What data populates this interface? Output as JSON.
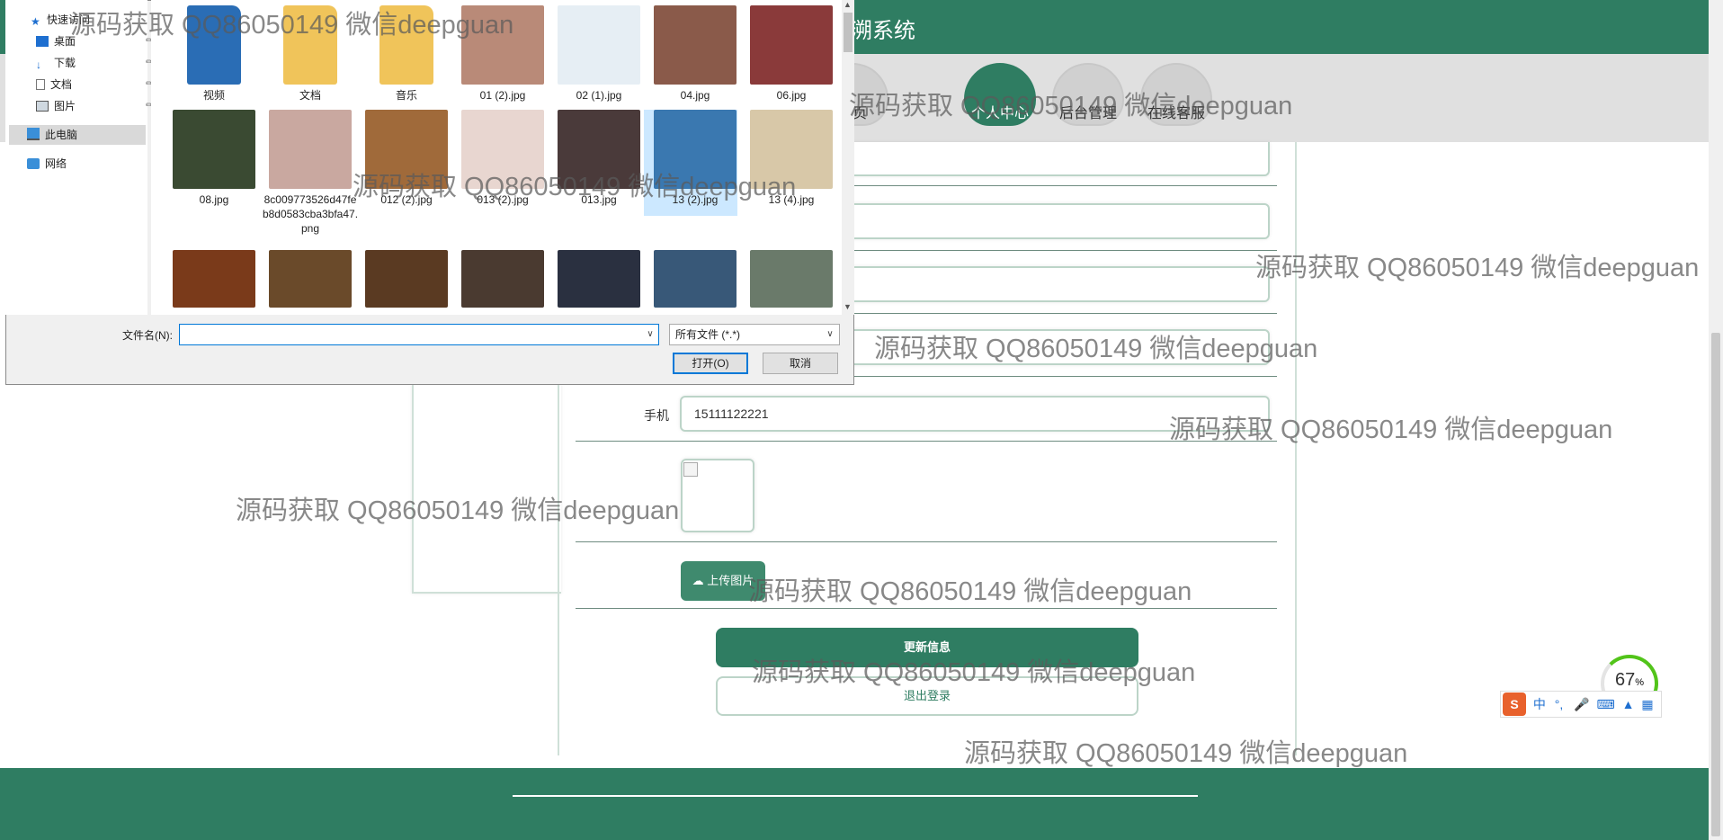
{
  "site": {
    "title": "溯系统",
    "nav": [
      "首页",
      "个人中心",
      "后台管理",
      "在线客服"
    ],
    "active_nav": 1
  },
  "form": {
    "phone_label": "手机",
    "phone_value": "15111122221",
    "upload_label": "上传图片",
    "update_label": "更新信息",
    "logout_label": "退出登录"
  },
  "dialog": {
    "sidebar": {
      "quick_access": "快速访问",
      "desktop": "桌面",
      "downloads": "下载",
      "documents": "文档",
      "pictures": "图片",
      "this_pc": "此电脑",
      "network": "网络"
    },
    "files": [
      {
        "name": "视频",
        "kind": "folder",
        "color": "#2a6db5"
      },
      {
        "name": "文档",
        "kind": "folder",
        "color": "#f0c45a"
      },
      {
        "name": "音乐",
        "kind": "folder",
        "color": "#f0c45a"
      },
      {
        "name": "01 (2).jpg",
        "kind": "image",
        "color": "#b98a78"
      },
      {
        "name": "02 (1).jpg",
        "kind": "image",
        "color": "#e6eef4"
      },
      {
        "name": "04.jpg",
        "kind": "image",
        "color": "#8a5a4a"
      },
      {
        "name": "06.jpg",
        "kind": "image",
        "color": "#8a3a3a"
      },
      {
        "name": "08.jpg",
        "kind": "image",
        "color": "#3a4a32"
      },
      {
        "name": "8c009773526d47feb8d0583cba3bfa47.png",
        "kind": "image",
        "color": "#c9a8a0"
      },
      {
        "name": "012 (2).jpg",
        "kind": "image",
        "color": "#a06a3a"
      },
      {
        "name": "013 (2).jpg",
        "kind": "image",
        "color": "#e8d6d0"
      },
      {
        "name": "013.jpg",
        "kind": "image",
        "color": "#4a3a3a"
      },
      {
        "name": "13 (2).jpg",
        "kind": "image",
        "color": "#3a78b0"
      },
      {
        "name": "13 (4).jpg",
        "kind": "image",
        "color": "#d8c8a8"
      },
      {
        "name": "",
        "kind": "image",
        "color": "#7a3a1a"
      },
      {
        "name": "",
        "kind": "image",
        "color": "#6a4a2a"
      },
      {
        "name": "",
        "kind": "image",
        "color": "#5a3a22"
      },
      {
        "name": "",
        "kind": "image",
        "color": "#4a3a30"
      },
      {
        "name": "",
        "kind": "image",
        "color": "#2a3040"
      },
      {
        "name": "",
        "kind": "image",
        "color": "#385878"
      },
      {
        "name": "",
        "kind": "image",
        "color": "#6a7a6a"
      }
    ],
    "filename_label": "文件名(N):",
    "filename_value": "",
    "filetype": "所有文件 (*.*)",
    "open_label": "打开(O)",
    "cancel_label": "取消"
  },
  "watermark": "源码获取 QQ86050149 微信deepguan",
  "ime": {
    "logo": "S",
    "lang": "中",
    "punct": "°,"
  },
  "gauge": {
    "value": "67",
    "unit": "%"
  },
  "colors": {
    "primary": "#2f7d62",
    "nav_bg": "#e0e0e0",
    "dialog_bg": "#f0f0f0",
    "select_blue": "#cce8ff"
  }
}
